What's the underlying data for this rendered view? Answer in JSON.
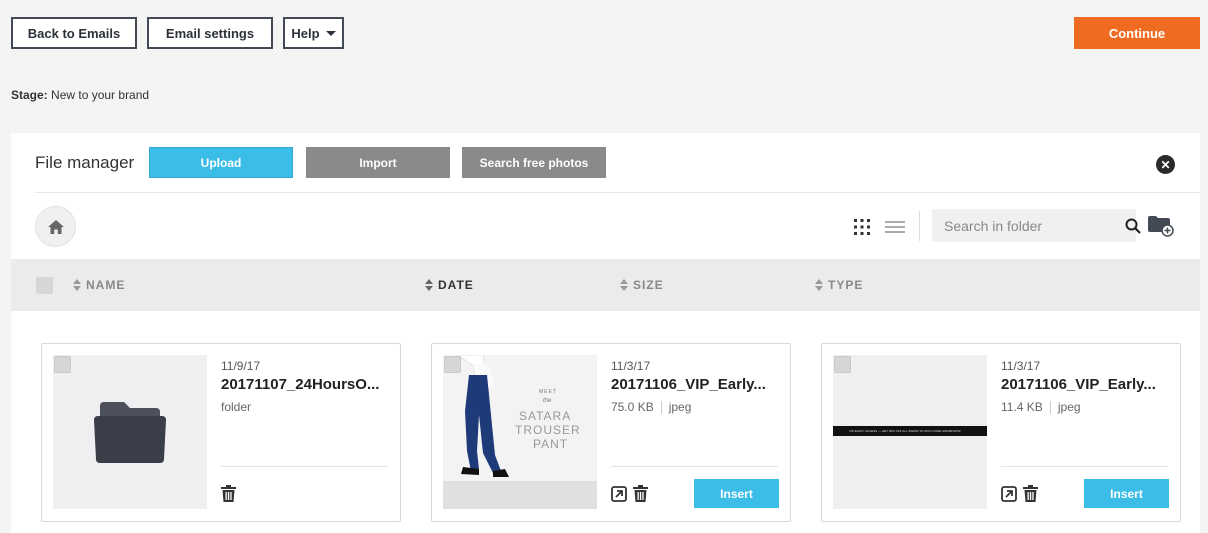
{
  "toolbar": {
    "back_label": "Back to Emails",
    "settings_label": "Email settings",
    "help_label": "Help",
    "continue_label": "Continue"
  },
  "stage": {
    "label": "Stage:",
    "value": "New to your brand"
  },
  "file_manager": {
    "title": "File manager",
    "upload_label": "Upload",
    "import_label": "Import",
    "search_photos_label": "Search free photos",
    "search_placeholder": "Search in folder",
    "columns": [
      "NAME",
      "DATE",
      "SIZE",
      "TYPE"
    ],
    "items": [
      {
        "date": "11/9/17",
        "name": "20171107_24HoursO...",
        "size": "",
        "type": "folder",
        "kind": "folder"
      },
      {
        "date": "11/3/17",
        "name": "20171106_VIP_Early...",
        "size": "75.0 KB",
        "type": "jpeg",
        "kind": "image",
        "insert_label": "Insert",
        "image_text": {
          "small": "MEET",
          "the": "the",
          "line1": "SATARA",
          "line2": "TROUSER",
          "line3": "PANT"
        }
      },
      {
        "date": "11/3/17",
        "name": "20171106_VIP_Early...",
        "size": "11.4 KB",
        "type": "jpeg",
        "kind": "image",
        "insert_label": "Insert",
        "banner_text": "VIP EARLY ACCESS — GET 30% OFF ALL SWAMI TO WITH CODE SWAMIVIP30"
      }
    ]
  },
  "colors": {
    "accent_orange": "#f06b22",
    "upload_blue": "#3bbde8",
    "gray_button": "#8a8a8a"
  },
  "icons": [
    "caret-down-icon",
    "close-icon",
    "home-icon",
    "grid-view-icon",
    "list-view-icon",
    "search-icon",
    "new-folder-icon",
    "folder-icon",
    "trash-icon",
    "open-external-icon"
  ]
}
